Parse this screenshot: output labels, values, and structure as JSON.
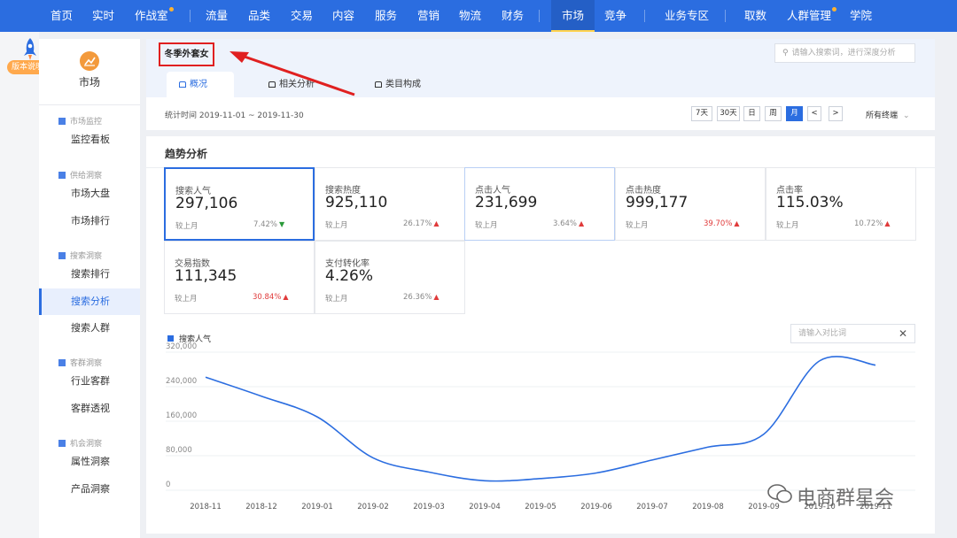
{
  "nav": {
    "items": [
      {
        "label": "首页"
      },
      {
        "label": "实时"
      },
      {
        "label": "作战室"
      },
      {
        "label": "流量"
      },
      {
        "label": "品类"
      },
      {
        "label": "交易"
      },
      {
        "label": "内容"
      },
      {
        "label": "服务"
      },
      {
        "label": "营销"
      },
      {
        "label": "物流"
      },
      {
        "label": "财务"
      },
      {
        "label": "市场"
      },
      {
        "label": "竞争"
      },
      {
        "label": "业务专区"
      },
      {
        "label": "取数"
      },
      {
        "label": "人群管理"
      },
      {
        "label": "学院"
      }
    ],
    "active": "市场"
  },
  "rail": {
    "version_label": "版本说明"
  },
  "sidebar": {
    "title": "市场",
    "groups": [
      {
        "label": "市场监控",
        "items": [
          "监控看板"
        ]
      },
      {
        "label": "供给洞察",
        "items": [
          "市场大盘",
          "市场排行"
        ]
      },
      {
        "label": "搜索洞察",
        "items": [
          "搜索排行",
          "搜索分析",
          "搜索人群"
        ]
      },
      {
        "label": "客群洞察",
        "items": [
          "行业客群",
          "客群透视"
        ]
      },
      {
        "label": "机会洞察",
        "items": [
          "属性洞察",
          "产品洞察"
        ]
      }
    ],
    "active_item": "搜索分析"
  },
  "header": {
    "keyword": "冬季外套女",
    "search_placeholder": "请输入搜索词，进行深度分析",
    "tabs": [
      "概况",
      "相关分析",
      "类目构成"
    ],
    "active_tab": "概况",
    "period": "统计时间 2019-11-01 ~ 2019-11-30",
    "date_buttons": [
      "7天",
      "30天",
      "日",
      "周",
      "月",
      "<",
      ">"
    ],
    "active_date_button": "月",
    "terminal": "所有终端"
  },
  "trend": {
    "title": "趋势分析",
    "compare_label": "较上月",
    "metrics": [
      {
        "label": "搜索人气",
        "value": "297,106",
        "pct": "7.42%",
        "dir": "down",
        "pct_color": "gray"
      },
      {
        "label": "搜索热度",
        "value": "925,110",
        "pct": "26.17%",
        "dir": "up",
        "pct_color": "gray"
      },
      {
        "label": "点击人气",
        "value": "231,699",
        "pct": "3.64%",
        "dir": "up",
        "pct_color": "gray"
      },
      {
        "label": "点击热度",
        "value": "999,177",
        "pct": "39.70%",
        "dir": "up",
        "pct_color": "red"
      },
      {
        "label": "点击率",
        "value": "115.03%",
        "pct": "10.72%",
        "dir": "up",
        "pct_color": "gray"
      },
      {
        "label": "交易指数",
        "value": "111,345",
        "pct": "30.84%",
        "dir": "up",
        "pct_color": "red"
      },
      {
        "label": "支付转化率",
        "value": "4.26%",
        "pct": "26.36%",
        "dir": "up",
        "pct_color": "gray"
      }
    ],
    "compare_placeholder": "请输入对比词",
    "accent_color": "#2b6de0"
  },
  "chart_data": {
    "type": "line",
    "x": [
      "2018-11",
      "2018-12",
      "2019-01",
      "2019-02",
      "2019-03",
      "2019-04",
      "2019-05",
      "2019-06",
      "2019-07",
      "2019-08",
      "2019-09",
      "2019-10",
      "2019-11"
    ],
    "series": [
      {
        "name": "搜索人气",
        "values": [
          262000,
          218000,
          170000,
          75000,
          42000,
          22000,
          27000,
          40000,
          70000,
          100000,
          130000,
          300000,
          290000
        ]
      }
    ],
    "y_ticks": [
      "0",
      "80,000",
      "160,000",
      "240,000",
      "320,000"
    ],
    "ylim": [
      0,
      320000
    ],
    "grid": true,
    "legend": "top-left"
  },
  "watermark": "电商群星会"
}
